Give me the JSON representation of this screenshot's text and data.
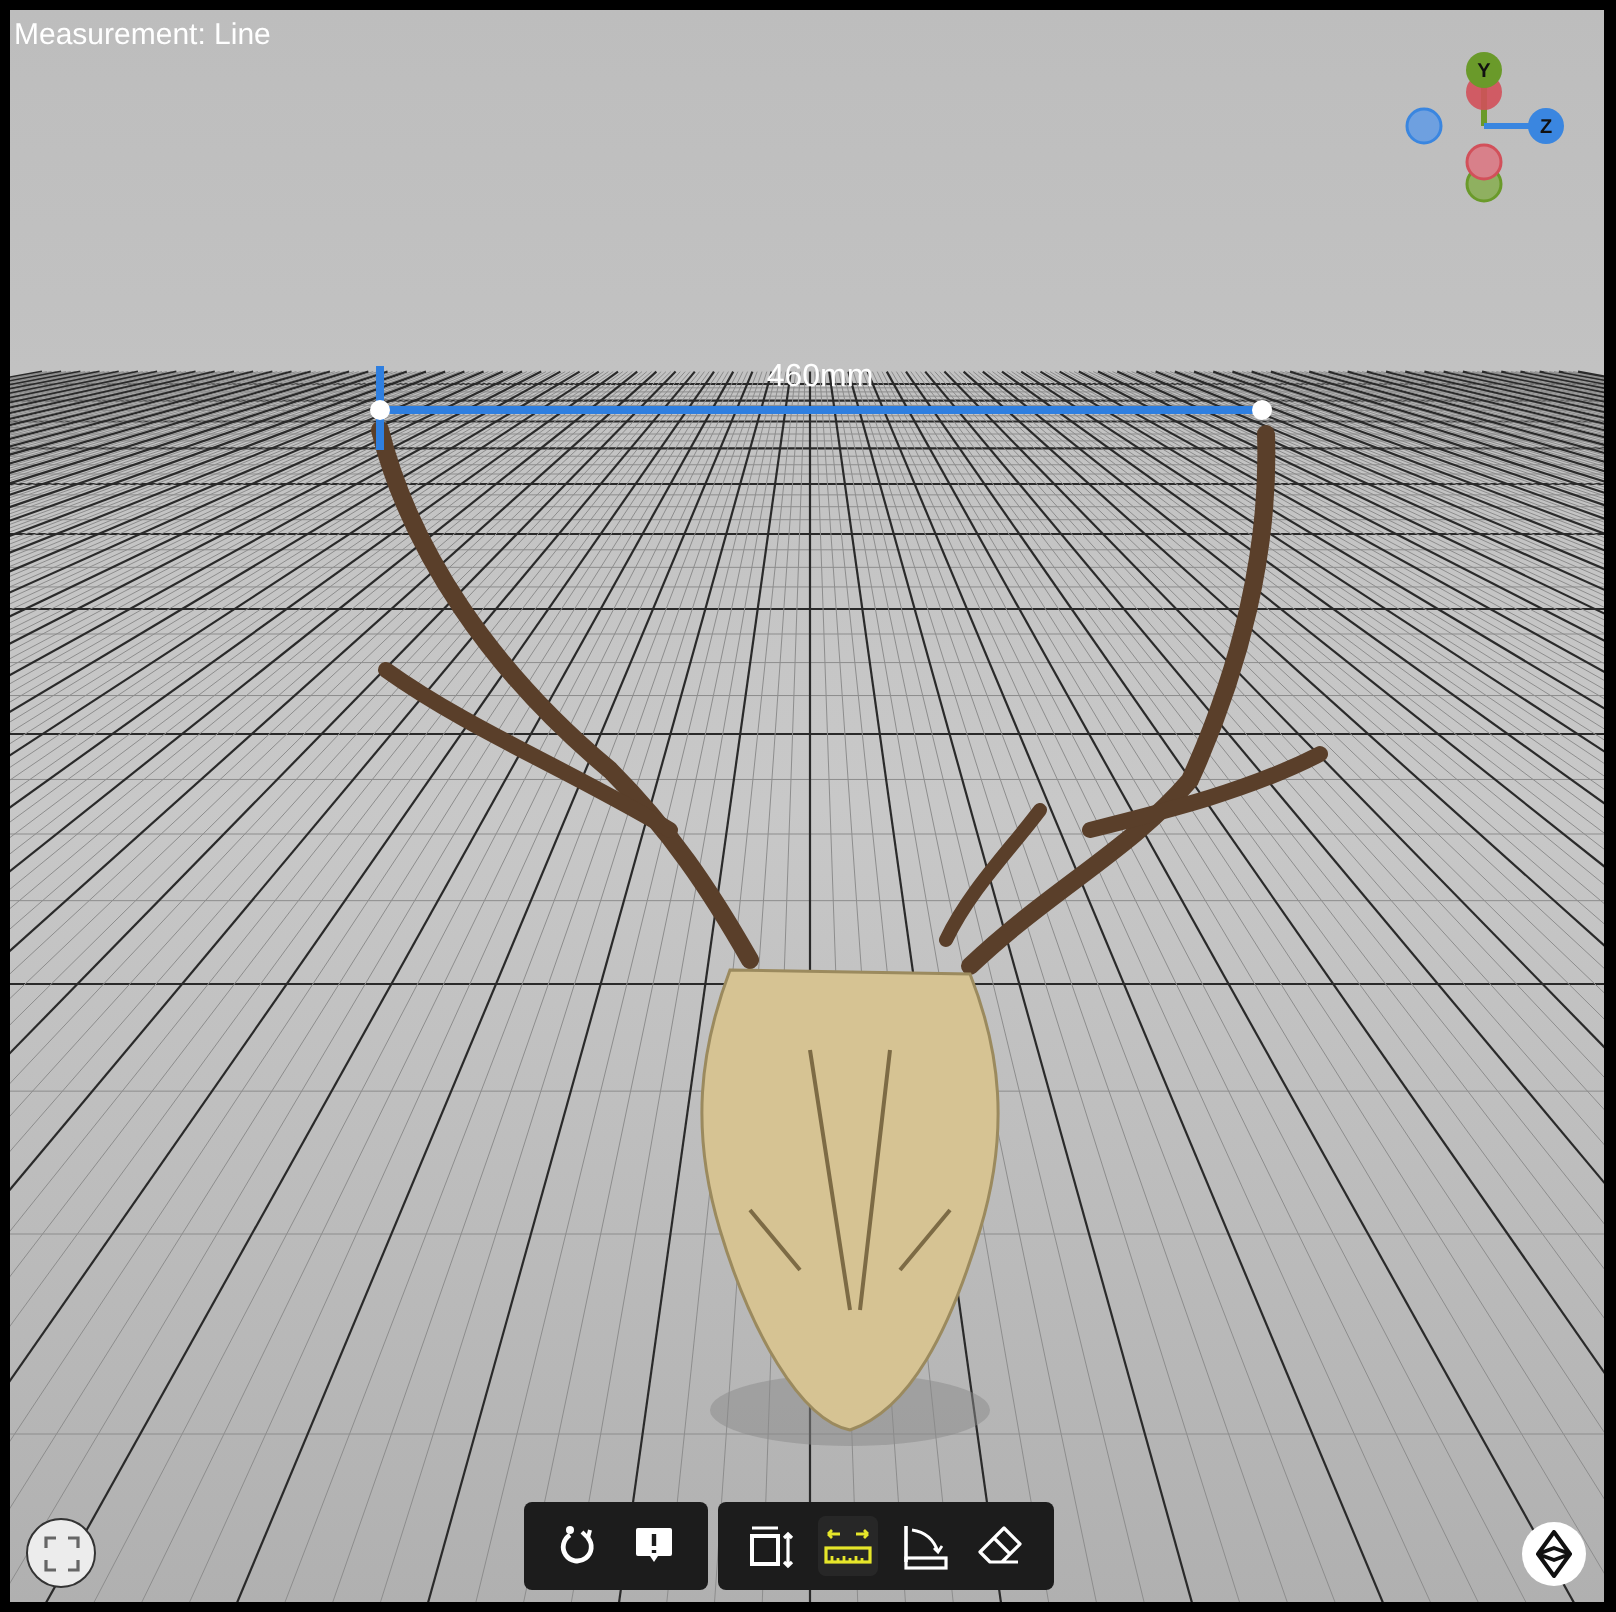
{
  "viewer": {
    "title": "Measurement: Line",
    "measurement": {
      "label": "460mm"
    },
    "axis_gizmo": {
      "labels": [
        "Y",
        "Z"
      ]
    },
    "toolbar": {
      "groups": [
        {
          "tools": [
            {
              "kind": "reset",
              "selected": false
            },
            {
              "kind": "annotation",
              "selected": false
            }
          ]
        },
        {
          "tools": [
            {
              "kind": "dimensions",
              "selected": false
            },
            {
              "kind": "measure-line",
              "selected": true
            },
            {
              "kind": "measure-angle",
              "selected": false
            },
            {
              "kind": "eraser",
              "selected": false
            }
          ]
        }
      ]
    }
  }
}
